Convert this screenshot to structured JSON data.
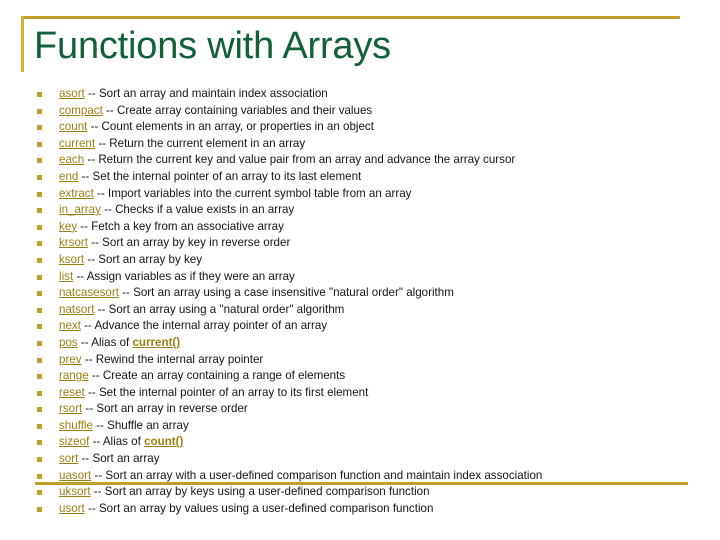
{
  "slide": {
    "title": "Functions with Arrays",
    "accent_gold": "#bf9f28",
    "title_green": "#11603a",
    "link_gold": "#9b8016",
    "body_color": "#151515",
    "items": [
      {
        "name": "asort",
        "sep": " -- ",
        "desc": "Sort an array and maintain index association",
        "alias": ""
      },
      {
        "name": "compact",
        "sep": " --  ",
        "desc": "Create array containing variables and their values",
        "alias": ""
      },
      {
        "name": "count",
        "sep": " -- ",
        "desc": "Count elements in an array, or properties in an object",
        "alias": ""
      },
      {
        "name": "current",
        "sep": " -- ",
        "desc": "Return the current element in an array",
        "alias": ""
      },
      {
        "name": "each",
        "sep": " --  ",
        "desc": "Return the current key and value pair from an array and advance the array cursor",
        "alias": ""
      },
      {
        "name": "end",
        "sep": " --  ",
        "desc": "Set the internal pointer of an array to its last element",
        "alias": ""
      },
      {
        "name": "extract",
        "sep": " --  ",
        "desc": "Import variables into the current symbol table from an array",
        "alias": ""
      },
      {
        "name": "in_array",
        "sep": " -- ",
        "desc": "Checks if a value exists in an array",
        "alias": ""
      },
      {
        "name": "key",
        "sep": " -- ",
        "desc": "Fetch a key from an associative array",
        "alias": ""
      },
      {
        "name": "krsort",
        "sep": " -- ",
        "desc": "Sort an array by key in reverse order",
        "alias": ""
      },
      {
        "name": "ksort",
        "sep": " -- ",
        "desc": "Sort an array by key",
        "alias": ""
      },
      {
        "name": "list",
        "sep": " --  ",
        "desc": "Assign variables as if they were an array",
        "alias": ""
      },
      {
        "name": "natcasesort",
        "sep": " --  ",
        "desc": "Sort an array using a case insensitive \"natural order\" algorithm",
        "alias": ""
      },
      {
        "name": "natsort",
        "sep": " --  ",
        "desc": "Sort an array using a \"natural order\" algorithm",
        "alias": ""
      },
      {
        "name": "next",
        "sep": " --  ",
        "desc": "Advance the internal array pointer of an array",
        "alias": ""
      },
      {
        "name": "pos",
        "sep": " -- ",
        "desc": "Alias of ",
        "alias": "current()"
      },
      {
        "name": "prev",
        "sep": " -- ",
        "desc": "Rewind the internal array pointer",
        "alias": ""
      },
      {
        "name": "range",
        "sep": " --  ",
        "desc": "Create an array containing a range of elements",
        "alias": ""
      },
      {
        "name": "reset",
        "sep": " --  ",
        "desc": "Set the internal pointer of an array to its first element",
        "alias": ""
      },
      {
        "name": "rsort",
        "sep": " -- ",
        "desc": "Sort an array in reverse order",
        "alias": ""
      },
      {
        "name": "shuffle",
        "sep": " -- ",
        "desc": "Shuffle an array",
        "alias": ""
      },
      {
        "name": "sizeof",
        "sep": " -- ",
        "desc": "Alias of ",
        "alias": "count()"
      },
      {
        "name": "sort",
        "sep": " -- ",
        "desc": "Sort an array",
        "alias": ""
      },
      {
        "name": "uasort",
        "sep": " --  ",
        "desc": "Sort an array with a user-defined comparison function and maintain index association",
        "alias": ""
      },
      {
        "name": "uksort",
        "sep": " --  ",
        "desc": "Sort an array by keys using a user-defined comparison function",
        "alias": ""
      },
      {
        "name": "usort",
        "sep": " --  ",
        "desc": "Sort an array by values using a user-defined comparison function",
        "alias": ""
      }
    ]
  }
}
